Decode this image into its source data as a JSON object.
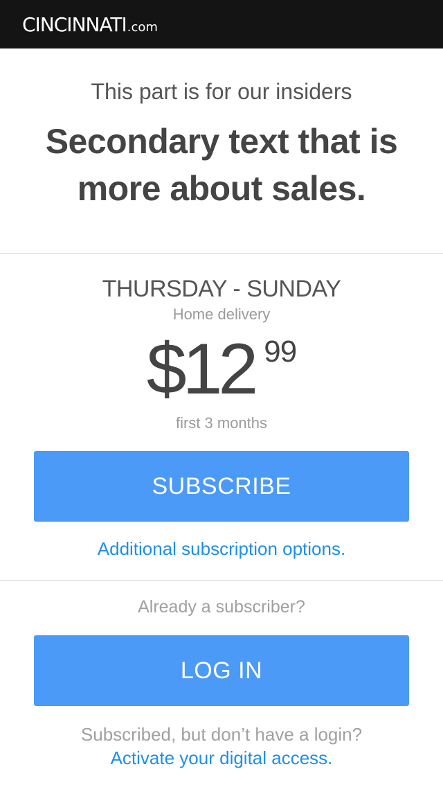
{
  "header": {
    "logo_main": "CINCINNATI",
    "logo_suffix": ".com"
  },
  "hero": {
    "kicker": "This part is for our insiders",
    "title": "Secondary text that is more about sales."
  },
  "plan": {
    "days": "THURSDAY - SUNDAY",
    "type": "Home delivery",
    "price_dollars": "$12",
    "price_cents": "99",
    "term": "first 3 months",
    "subscribe_label": "SUBSCRIBE",
    "options_link": "Additional subscription options."
  },
  "login": {
    "prompt": "Already a subscriber?",
    "button_label": "LOG IN",
    "no_login_text": "Subscribed, but don’t have a login?",
    "activate_link": "Activate your digital access."
  },
  "colors": {
    "topbar": "#141414",
    "button": "#4b9af7",
    "link": "#1e8fe6"
  }
}
